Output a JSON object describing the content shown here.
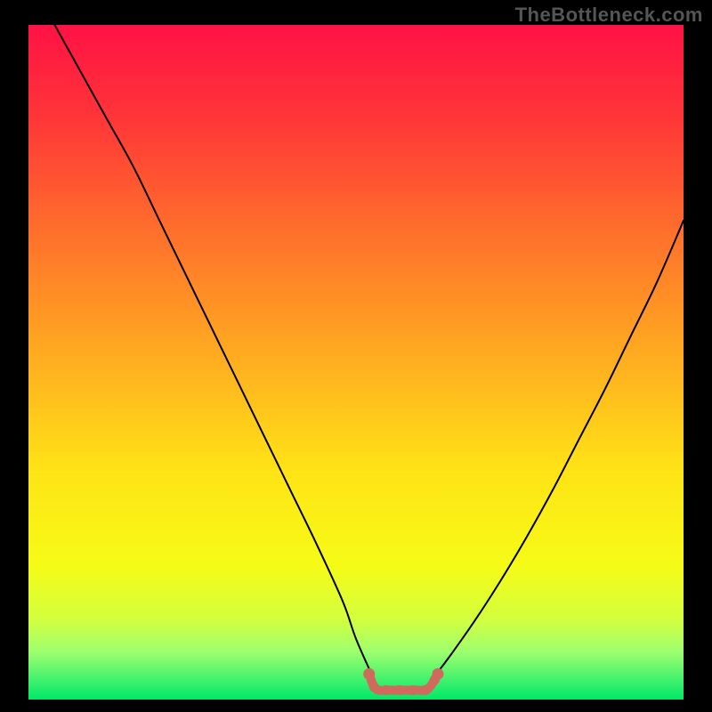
{
  "watermark": "TheBottleneck.com",
  "chart_data": {
    "type": "line",
    "title": "",
    "xlabel": "",
    "ylabel": "",
    "xlim": [
      0,
      100
    ],
    "ylim": [
      0,
      100
    ],
    "grid": false,
    "legend": false,
    "background_gradient_stops": [
      {
        "offset": 0,
        "color": "#ff1245"
      },
      {
        "offset": 14,
        "color": "#ff3638"
      },
      {
        "offset": 30,
        "color": "#ff6d2c"
      },
      {
        "offset": 48,
        "color": "#ffa821"
      },
      {
        "offset": 66,
        "color": "#ffe316"
      },
      {
        "offset": 80,
        "color": "#f6fb16"
      },
      {
        "offset": 88,
        "color": "#d4ff3e"
      },
      {
        "offset": 93,
        "color": "#9cff6f"
      },
      {
        "offset": 100,
        "color": "#00e86a"
      }
    ],
    "series": [
      {
        "name": "bottleneck-curve-left",
        "color": "#000000",
        "x": [
          4,
          8,
          12,
          16,
          20,
          24,
          28,
          32,
          36,
          40,
          44,
          48,
          50,
          52.5
        ],
        "y": [
          100,
          93,
          86,
          79,
          71,
          63,
          55,
          47,
          39,
          31,
          23,
          14.5,
          9,
          3.5
        ]
      },
      {
        "name": "bottleneck-curve-right",
        "color": "#000000",
        "x": [
          62,
          64,
          68,
          72,
          76,
          80,
          84,
          88,
          92,
          96,
          100
        ],
        "y": [
          3.5,
          6,
          11.5,
          17.5,
          24,
          31,
          38.5,
          46,
          54,
          62,
          71
        ]
      },
      {
        "name": "trough-band",
        "color": "#cf6a5c",
        "x": [
          52,
          53,
          55,
          57,
          59,
          61,
          62.5
        ],
        "y": [
          3.8,
          1.6,
          1.4,
          1.4,
          1.4,
          1.6,
          3.8
        ]
      }
    ],
    "annotations": []
  }
}
